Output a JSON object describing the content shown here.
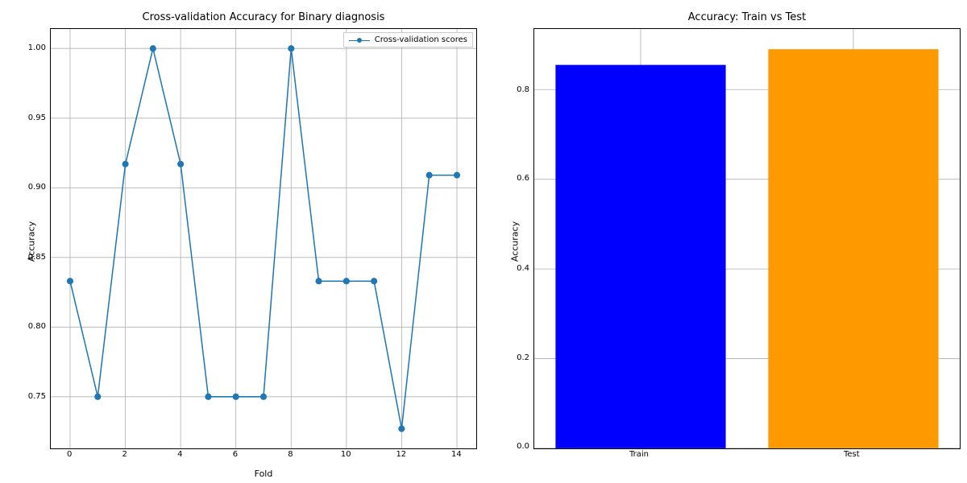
{
  "chart_data": [
    {
      "type": "line",
      "title": "Cross-validation Accuracy for Binary diagnosis",
      "xlabel": "Fold",
      "ylabel": "Accuracy",
      "legend": "Cross-validation scores",
      "x": [
        0,
        1,
        2,
        3,
        4,
        5,
        6,
        7,
        8,
        9,
        10,
        11,
        12,
        13,
        14
      ],
      "values": [
        0.833,
        0.75,
        0.917,
        1.0,
        0.917,
        0.75,
        0.75,
        0.75,
        1.0,
        0.833,
        0.833,
        0.833,
        0.727,
        0.909,
        0.909
      ],
      "xlim": [
        -0.7,
        14.7
      ],
      "ylim": [
        0.713,
        1.014
      ],
      "xticks": [
        0,
        2,
        4,
        6,
        8,
        10,
        12,
        14
      ],
      "yticks": [
        0.75,
        0.8,
        0.85,
        0.9,
        0.95,
        1.0
      ],
      "ytick_labels": [
        "0.75",
        "0.80",
        "0.85",
        "0.90",
        "0.95",
        "1.00"
      ]
    },
    {
      "type": "bar",
      "title": "Accuracy: Train vs Test",
      "xlabel": "",
      "ylabel": "Accuracy",
      "categories": [
        "Train",
        "Test"
      ],
      "values": [
        0.855,
        0.89
      ],
      "colors": [
        "#0000ff",
        "#ff9900"
      ],
      "ylim": [
        0.0,
        0.935
      ],
      "yticks": [
        0.0,
        0.2,
        0.4,
        0.6,
        0.8
      ],
      "ytick_labels": [
        "0.0",
        "0.2",
        "0.4",
        "0.6",
        "0.8"
      ]
    }
  ]
}
